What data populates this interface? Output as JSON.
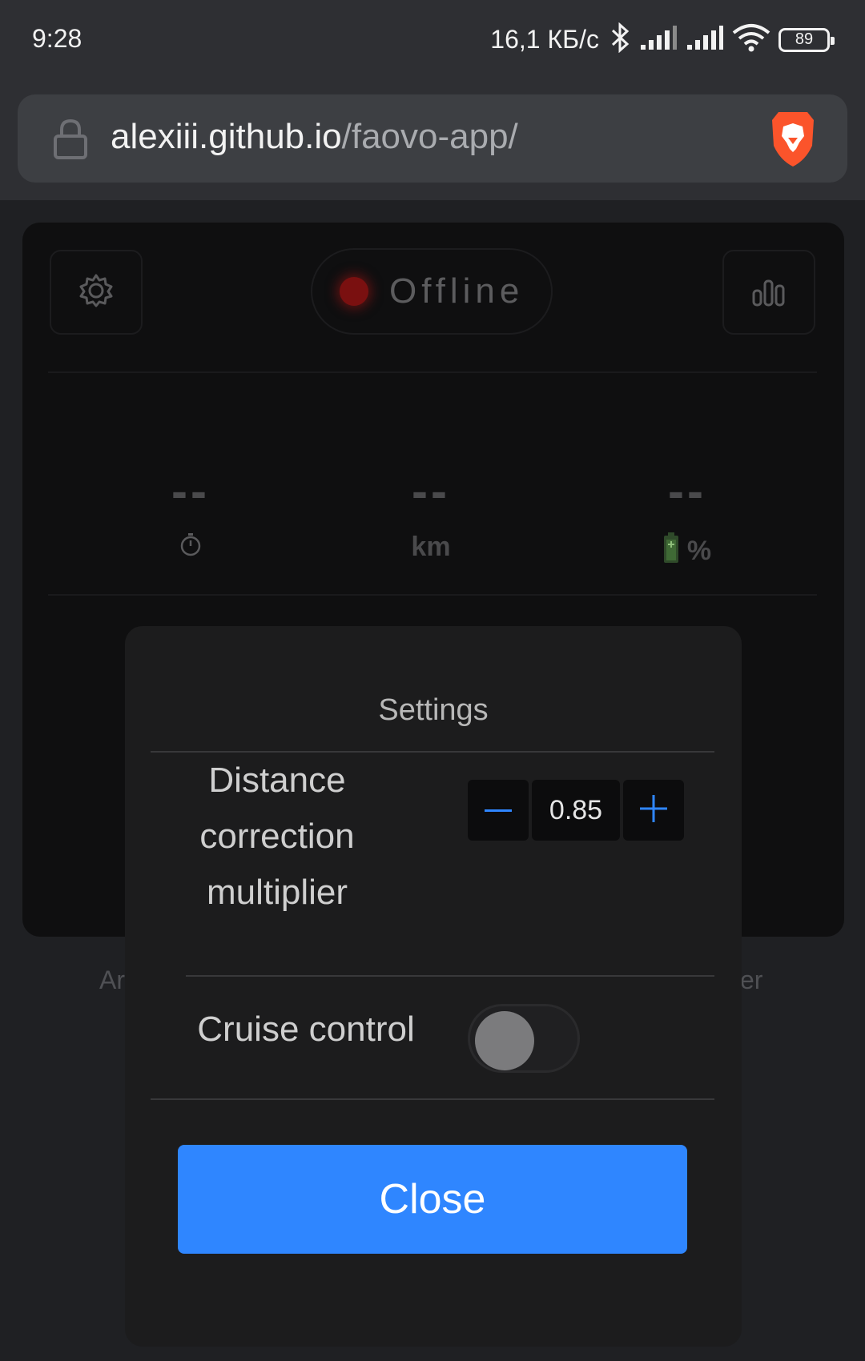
{
  "status_bar": {
    "time": "9:28",
    "net_speed": "16,1 КБ/с",
    "battery": "89",
    "icons": [
      "bluetooth-icon",
      "signal-icon",
      "signal-icon",
      "wifi-icon",
      "battery-icon"
    ]
  },
  "browser": {
    "url_host": "alexiii.github.io",
    "url_path": "/faovo-app/",
    "icons": [
      "lock-icon",
      "brave-lion-icon"
    ]
  },
  "app": {
    "connection_status": "Offline",
    "status_color": "#7a1010",
    "buttons": [
      "settings-gear-icon",
      "stats-bars-icon"
    ],
    "stats": [
      {
        "value": "--",
        "unit": "",
        "icon": "stopwatch-icon"
      },
      {
        "value": "--",
        "unit": "km",
        "icon": ""
      },
      {
        "value": "--",
        "unit": "%",
        "icon": "battery-icon"
      }
    ],
    "bottom_left_text": "Ar",
    "bottom_right_text": "er"
  },
  "settings_modal": {
    "title": "Settings",
    "distance_label": "Distance correction multiplier",
    "distance_label_lines": [
      "Distance",
      "correction",
      "multiplier"
    ],
    "distance_value": "0.85",
    "minus_symbol": "–",
    "plus_symbol": "+",
    "cruise_label": "Cruise control",
    "cruise_enabled": false,
    "close_label": "Close",
    "accent_color": "#2f86ff"
  }
}
